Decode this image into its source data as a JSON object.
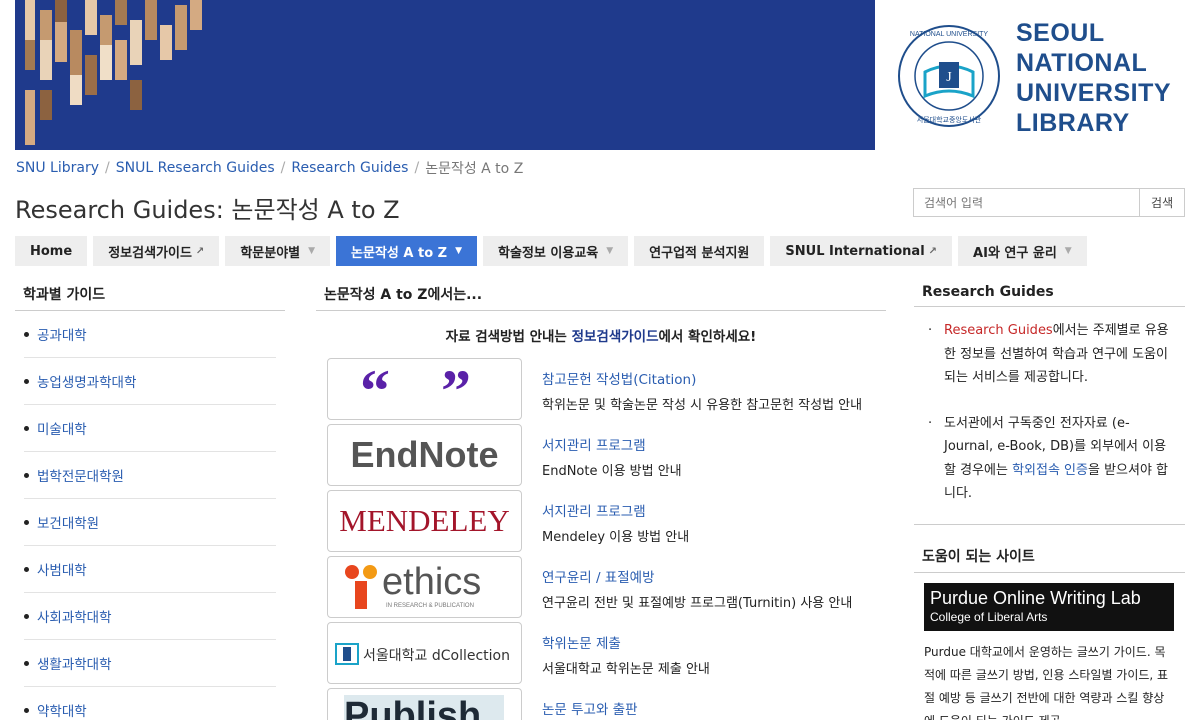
{
  "logo": {
    "line1": "SEOUL",
    "line2": "NATIONAL",
    "line3": "UNIVERSITY",
    "line4": "LIBRARY"
  },
  "breadcrumb": [
    {
      "label": "SNU Library"
    },
    {
      "label": "SNUL Research Guides"
    },
    {
      "label": "Research Guides"
    },
    {
      "label": "논문작성 A to Z"
    }
  ],
  "page_title": "Research Guides: 논문작성 A to Z",
  "search": {
    "placeholder": "검색어 입력",
    "button": "검색"
  },
  "tabs": [
    {
      "label": "Home"
    },
    {
      "label": "정보검색가이드"
    },
    {
      "label": "학문분야별"
    },
    {
      "label": "논문작성 A to Z"
    },
    {
      "label": "학술정보 이용교육"
    },
    {
      "label": "연구업적 분석지원"
    },
    {
      "label": "SNUL International"
    },
    {
      "label": "AI와 연구 윤리"
    }
  ],
  "left": {
    "heading": "학과별 가이드",
    "items": [
      "공과대학",
      "농업생명과학대학",
      "미술대학",
      "법학전문대학원",
      "보건대학원",
      "사범대학",
      "사회과학대학",
      "생활과학대학",
      "약학대학"
    ]
  },
  "center": {
    "heading": "논문작성 A to Z에서는...",
    "intro_pre": "자료 검색방법 안내는 ",
    "intro_link": "정보검색가이드",
    "intro_post": "에서 확인하세요!",
    "rows": [
      {
        "thumb_text": "“ ”",
        "title": "참고문헌 작성법(Citation)",
        "desc": "학위논문 및 학술논문 작성 시 유용한 참고문헌 작성법 안내"
      },
      {
        "thumb_text": "EndNote",
        "title": "서지관리 프로그램",
        "desc": "EndNote 이용 방법 안내"
      },
      {
        "thumb_text": "MENDELEY",
        "title": "서지관리 프로그램",
        "desc": "Mendeley 이용 방법 안내"
      },
      {
        "thumb_text": "ethics",
        "thumb_sub": "IN RESEARCH & PUBLICATION",
        "title": "연구윤리 / 표절예방",
        "desc": "연구윤리 전반 및 표절예방 프로그램(Turnitin) 사용 안내"
      },
      {
        "thumb_text": "서울대학교 dCollection",
        "title": "학위논문 제출",
        "desc": "서울대학교 학위논문 제출 안내"
      },
      {
        "thumb_text": "Publish",
        "title": "논문 투고와 출판",
        "desc": ""
      }
    ]
  },
  "right": {
    "heading": "Research Guides",
    "item1_red": "Research Guides",
    "item1_rest": "에서는 주제별로 유용한 정보를 선별하여 학습과 연구에 도움이 되는 서비스를 제공합니다.",
    "item2_pre": "도서관에서 구독중인 전자자료 (e-Journal, e-Book, DB)를 외부에서 이용할 경우에는 ",
    "item2_link": "학외접속 인증",
    "item2_post": "을 받으셔야 합니다.",
    "sites_heading": "도움이 되는 사이트",
    "purdue_line1": "Purdue Online Writing Lab",
    "purdue_line2": "College of Liberal Arts",
    "purdue_desc": "Purdue 대학교에서 운영하는 글쓰기 가이드. 목적에 따른 글쓰기 방법, 인용 스타일별 가이드, 표절 예방 등 글쓰기 전반에 대한 역량과 스킬 향상에 도움이 되는 가이드 제공."
  },
  "colors": {
    "banner": "#1f3a8c",
    "link": "#2a5db0",
    "active_tab": "#3b74d6",
    "logo": "#1f4e8c",
    "accent_red": "#c62828"
  }
}
